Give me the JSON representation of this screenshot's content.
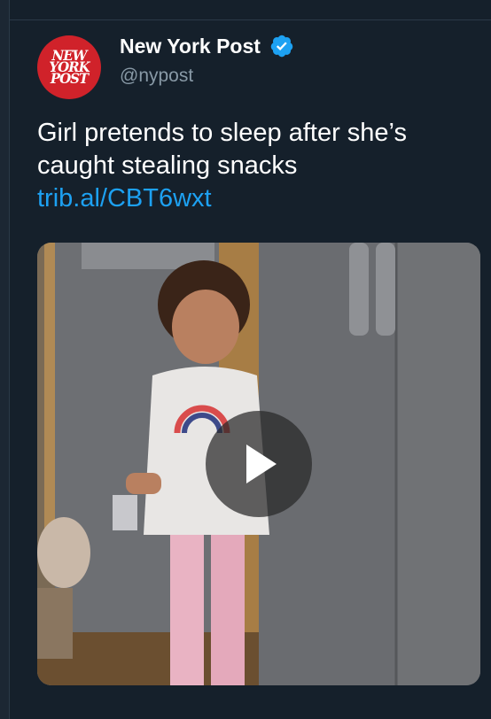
{
  "tweet": {
    "display_name": "New York Post",
    "handle": "@nypost",
    "verified": true,
    "text": "Girl pretends to sleep after she’s caught stealing snacks",
    "link": "trib.al/CBT6wxt",
    "avatar_logo_lines": [
      "NEW",
      "YORK",
      "POST"
    ]
  },
  "media": {
    "type": "video",
    "play_icon": "play-icon"
  },
  "colors": {
    "background": "#15202b",
    "link": "#1da1f2",
    "secondary_text": "#8899a6",
    "avatar_red": "#d0222a",
    "verified_blue": "#1da1f2"
  }
}
